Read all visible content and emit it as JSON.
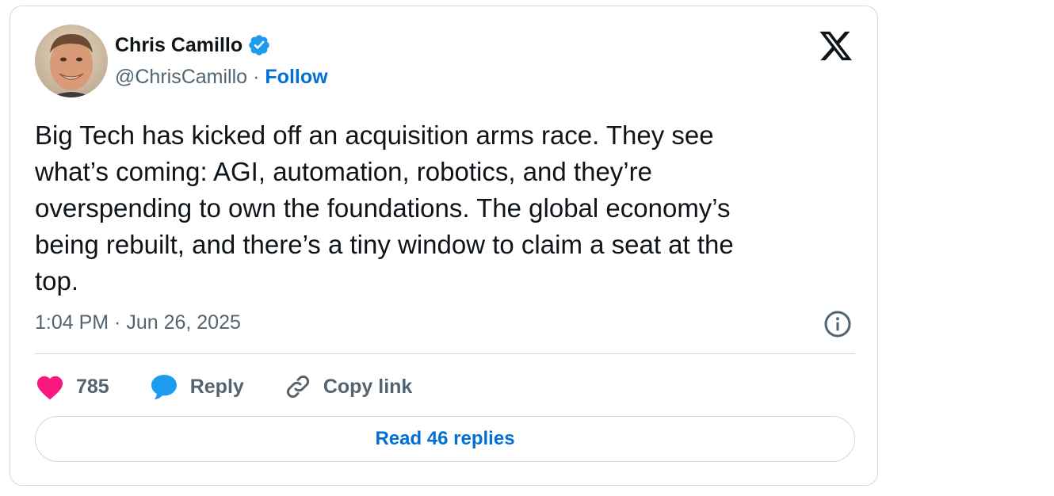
{
  "author": {
    "name": "Chris Camillo",
    "handle": "@ChrisCamillo",
    "separator": "·",
    "follow_label": "Follow",
    "verified": true
  },
  "icons": {
    "verified": "verified-badge-icon",
    "brand": "x-logo-icon",
    "info": "info-icon",
    "like": "heart-icon",
    "reply": "speech-bubble-icon",
    "copy": "link-icon"
  },
  "tweet": {
    "text": "Big Tech has kicked off an acquisition arms race. They see\nwhat’s coming: AGI, automation, robotics, and they’re\noverspending to own the foundations. The global economy’s\nbeing rebuilt, and there’s a tiny window to claim a seat at the\ntop.",
    "timestamp": "1:04 PM · Jun 26, 2025"
  },
  "actions": {
    "like_count": "785",
    "reply_label": "Reply",
    "copy_label": "Copy link"
  },
  "replies_button": "Read 46 replies",
  "colors": {
    "like": "#f91880",
    "reply": "#1d9bf0",
    "link": "#006fd6",
    "verified": "#1d9bf0",
    "muted": "#536471",
    "border": "#cfd9de"
  }
}
